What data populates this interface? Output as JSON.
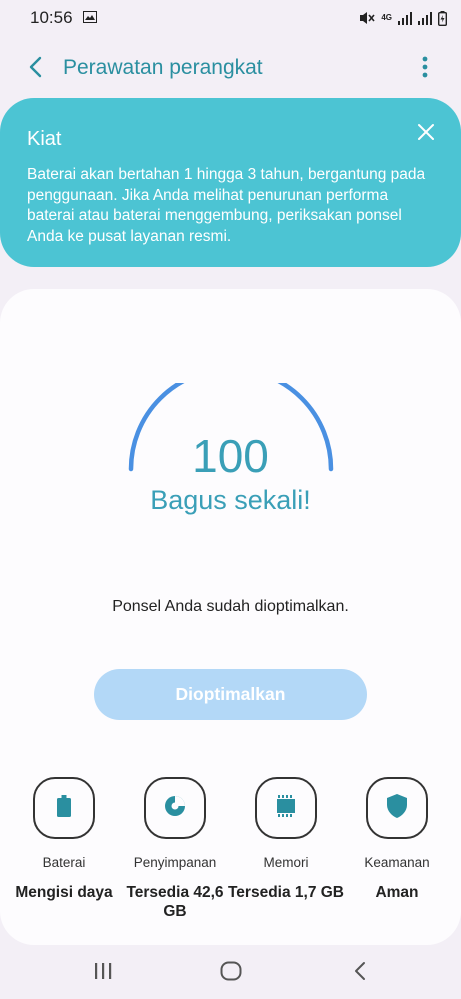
{
  "status_bar": {
    "time": "10:56",
    "network": "4G",
    "icons": [
      "image-icon",
      "mute-icon",
      "network-4g-icon",
      "signal-icon",
      "signal-icon",
      "battery-charging-icon"
    ]
  },
  "app_bar": {
    "title": "Perawatan perangkat",
    "back_icon": "back-arrow-icon",
    "more_icon": "more-vertical-icon"
  },
  "tip": {
    "title": "Kiat",
    "text": "Baterai akan bertahan 1 hingga 3 tahun, bergantung pada penggunaan. Jika Anda melihat penurunan performa baterai atau baterai menggembung, periksakan ponsel Anda ke pusat layanan resmi.",
    "close_icon": "close-icon"
  },
  "score": {
    "value": "100",
    "label": "Bagus sekali!",
    "gauge_fraction": 1.0
  },
  "status_message": "Ponsel Anda sudah dioptimalkan.",
  "optimize_button": "Dioptimalkan",
  "categories": [
    {
      "label": "Baterai",
      "value": "Mengisi daya",
      "icon": "battery-icon"
    },
    {
      "label": "Penyimpanan",
      "value": "Tersedia 42,6 GB",
      "icon": "storage-pie-icon"
    },
    {
      "label": "Memori",
      "value": "Tersedia 1,7 GB",
      "icon": "memory-chip-icon"
    },
    {
      "label": "Keamanan",
      "value": "Aman",
      "icon": "shield-icon"
    }
  ],
  "colors": {
    "accent": "#3a9fb7",
    "tip_background": "#4cc4d3",
    "button_disabled": "#b3d8f7",
    "gauge": "#4a90e2"
  },
  "nav_bar": [
    "recent-apps-icon",
    "home-icon",
    "back-icon"
  ]
}
